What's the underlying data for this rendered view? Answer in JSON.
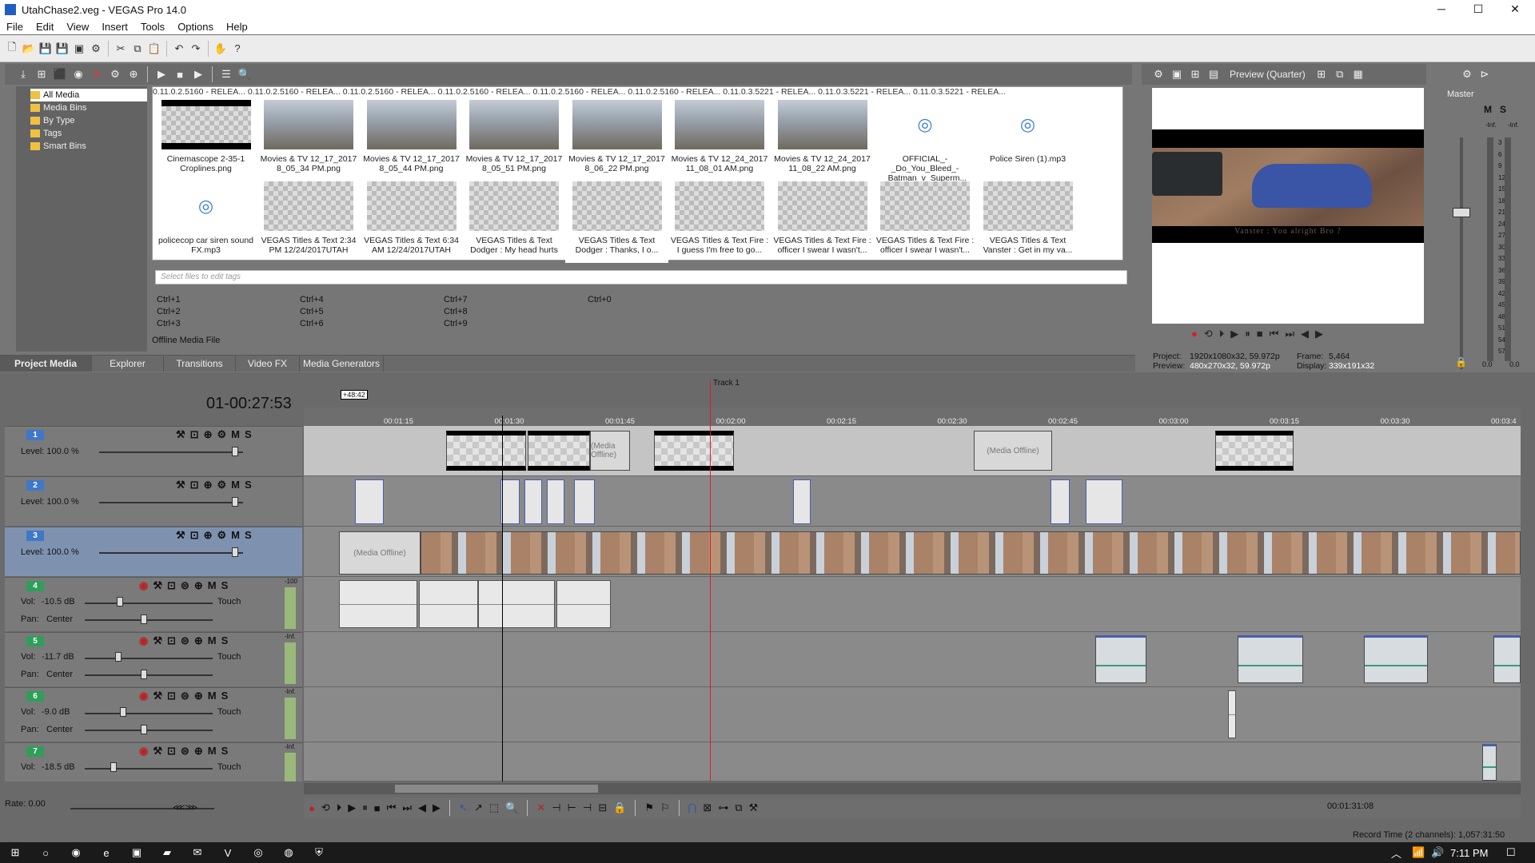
{
  "window": {
    "title": "UtahChase2.veg - VEGAS Pro 14.0",
    "minimize": "─",
    "maximize": "☐",
    "close": "✕"
  },
  "menu": [
    "File",
    "Edit",
    "View",
    "Insert",
    "Tools",
    "Options",
    "Help"
  ],
  "project_media": {
    "tree": [
      "All Media",
      "Media Bins",
      "By Type",
      "Tags",
      "Smart Bins"
    ],
    "version_strip": "0.11.0.2.5160 - RELEA...   0.11.0.2.5160 - RELEA...   0.11.0.2.5160 - RELEA...   0.11.0.2.5160 - RELEA...   0.11.0.2.5160 - RELEA...   0.11.0.2.5160 - RELEA...   0.11.0.3.5221 - RELEA...   0.11.0.3.5221 - RELEA...   0.11.0.3.5221 - RELEA...",
    "items": [
      {
        "name": "Cinemascope 2-35-1 Croplines.png",
        "kind": "cine"
      },
      {
        "name": "Movies & TV 12_17_2017 8_05_34 PM.png",
        "kind": "photo"
      },
      {
        "name": "Movies & TV 12_17_2017 8_05_44 PM.png",
        "kind": "photo"
      },
      {
        "name": "Movies & TV 12_17_2017 8_05_51 PM.png",
        "kind": "photo"
      },
      {
        "name": "Movies & TV 12_17_2017 8_06_22 PM.png",
        "kind": "photo"
      },
      {
        "name": "Movies & TV 12_24_2017 11_08_01 AM.png",
        "kind": "photo"
      },
      {
        "name": "Movies & TV 12_24_2017 11_08_22 AM.png",
        "kind": "photo"
      },
      {
        "name": "OFFICIAL_-_Do_You_Bleed_-_Batman_v_Superm...",
        "kind": "audio"
      },
      {
        "name": "Police Siren (1).mp3",
        "kind": "audio"
      },
      {
        "name": "policecop car siren sound FX.mp3",
        "kind": "audio"
      },
      {
        "name": "VEGAS Titles & Text 2:34 PM 12/24/2017UTAH",
        "kind": "check"
      },
      {
        "name": "VEGAS Titles & Text 6:34 AM 12/24/2017UTAH",
        "kind": "check"
      },
      {
        "name": "VEGAS Titles & Text Dodger : My head hurts",
        "kind": "check"
      },
      {
        "name": "VEGAS Titles & Text Dodger : Thanks, I o...",
        "kind": "check"
      },
      {
        "name": "VEGAS Titles & Text Fire : I guess I'm free to go...",
        "kind": "check"
      },
      {
        "name": "VEGAS Titles & Text Fire : officer I swear I wasn't...",
        "kind": "check"
      },
      {
        "name": "VEGAS Titles & Text Fire : officer I swear I wasn't...",
        "kind": "check"
      },
      {
        "name": "VEGAS Titles & Text Vanster : Get in my va...",
        "kind": "check"
      }
    ],
    "tags_placeholder": "Select files to edit tags",
    "shortcuts": [
      "Ctrl+1",
      "Ctrl+2",
      "Ctrl+3",
      "Ctrl+4",
      "Ctrl+5",
      "Ctrl+6",
      "Ctrl+7",
      "Ctrl+8",
      "Ctrl+9",
      "Ctrl+0"
    ],
    "status": "Offline Media File"
  },
  "tabs": [
    "Project Media",
    "Explorer",
    "Transitions",
    "Video FX",
    "Media Generators"
  ],
  "preview": {
    "mode": "Preview (Quarter)",
    "subtitle": "Vanster : You alright Bro ?",
    "project_label": "Project:",
    "project_value": "1920x1080x32, 59.972p",
    "preview_label": "Preview:",
    "preview_value": "480x270x32, 59.972p",
    "frame_label": "Frame:",
    "frame_value": "5,464",
    "display_label": "Display:",
    "display_value": "339x191x32"
  },
  "master": {
    "title": "Master",
    "m": "M",
    "s": "S",
    "scale": [
      "3",
      "6",
      "9",
      "12",
      "15",
      "18",
      "21",
      "24",
      "27",
      "30",
      "33",
      "36",
      "39",
      "42",
      "45",
      "48",
      "51",
      "54",
      "57"
    ],
    "inf": "-Inf.",
    "bottom_l": "0.0",
    "bottom_r": "0.0"
  },
  "timeline": {
    "timecode": "01-00:27:53",
    "marker": "Track 1",
    "loop_label": "+48:42",
    "ticks": [
      "00:01:15",
      "00:01:30",
      "00:01:45",
      "00:02:00",
      "00:02:15",
      "00:02:30",
      "00:02:45",
      "00:03:00",
      "00:03:15",
      "00:03:30",
      "00:03:4"
    ],
    "video_tracks": [
      {
        "num": "1",
        "level": "Level: 100.0 %"
      },
      {
        "num": "2",
        "level": "Level: 100.0 %"
      },
      {
        "num": "3",
        "level": "Level: 100.0 %"
      }
    ],
    "audio_tracks": [
      {
        "num": "4",
        "vol_label": "Vol:",
        "vol": "-10.5 dB",
        "pan_label": "Pan:",
        "pan": "Center",
        "touch": "Touch",
        "peak": "-100"
      },
      {
        "num": "5",
        "vol_label": "Vol:",
        "vol": "-11.7 dB",
        "pan_label": "Pan:",
        "pan": "Center",
        "touch": "Touch",
        "peak": "-Inf."
      },
      {
        "num": "6",
        "vol_label": "Vol:",
        "vol": "-9.0 dB",
        "pan_label": "Pan:",
        "pan": "Center",
        "touch": "Touch",
        "peak": "-Inf."
      },
      {
        "num": "7",
        "vol_label": "Vol:",
        "vol": "-18.5 dB",
        "touch": "Touch",
        "peak": "-Inf."
      }
    ],
    "media_offline": "(Media Offline)",
    "rate": "Rate: 0.00",
    "end_time": "00:01:31:08"
  },
  "status_bar": "Record Time (2 channels): 1,057:31:50",
  "taskbar": {
    "time": "7:11 PM"
  }
}
